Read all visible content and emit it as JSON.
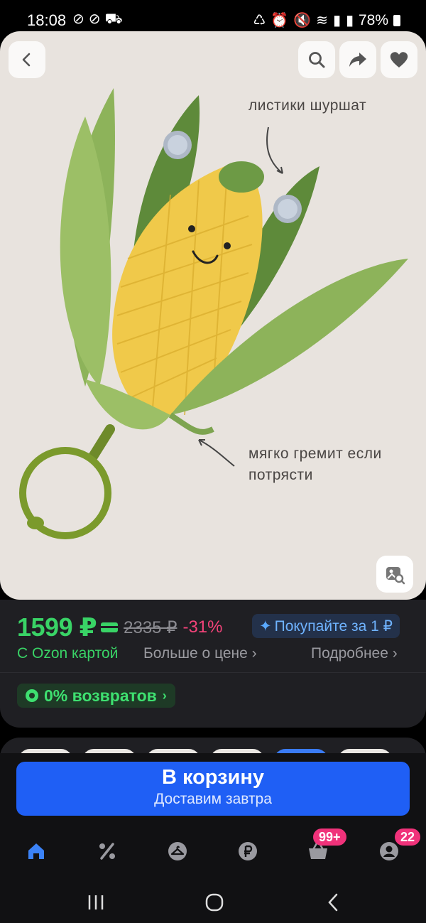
{
  "status_bar": {
    "time": "18:08",
    "battery": "78%"
  },
  "image": {
    "annotation_top": "листики шуршат",
    "annotation_bottom": "мягко гремит если потрясти"
  },
  "price": {
    "current": "1599 ₽",
    "old": "2335 ₽",
    "discount": "-31%",
    "promo": "Покупайте за 1 ₽",
    "ozon_card": "С Ozon картой",
    "more_price": "Больше о цене",
    "details": "Подробнее",
    "returns": "0% возвратов"
  },
  "cart": {
    "title": "В корзину",
    "subtitle": "Доставим завтра"
  },
  "tabs": {
    "cart_badge": "99+",
    "profile_badge": "22"
  },
  "colors": {
    "price_green": "#39d366",
    "discount_pink": "#f4437a",
    "cta_blue": "#1f5ff5",
    "badge_pink": "#f0327a",
    "promo_blue": "#6fb3ff"
  }
}
